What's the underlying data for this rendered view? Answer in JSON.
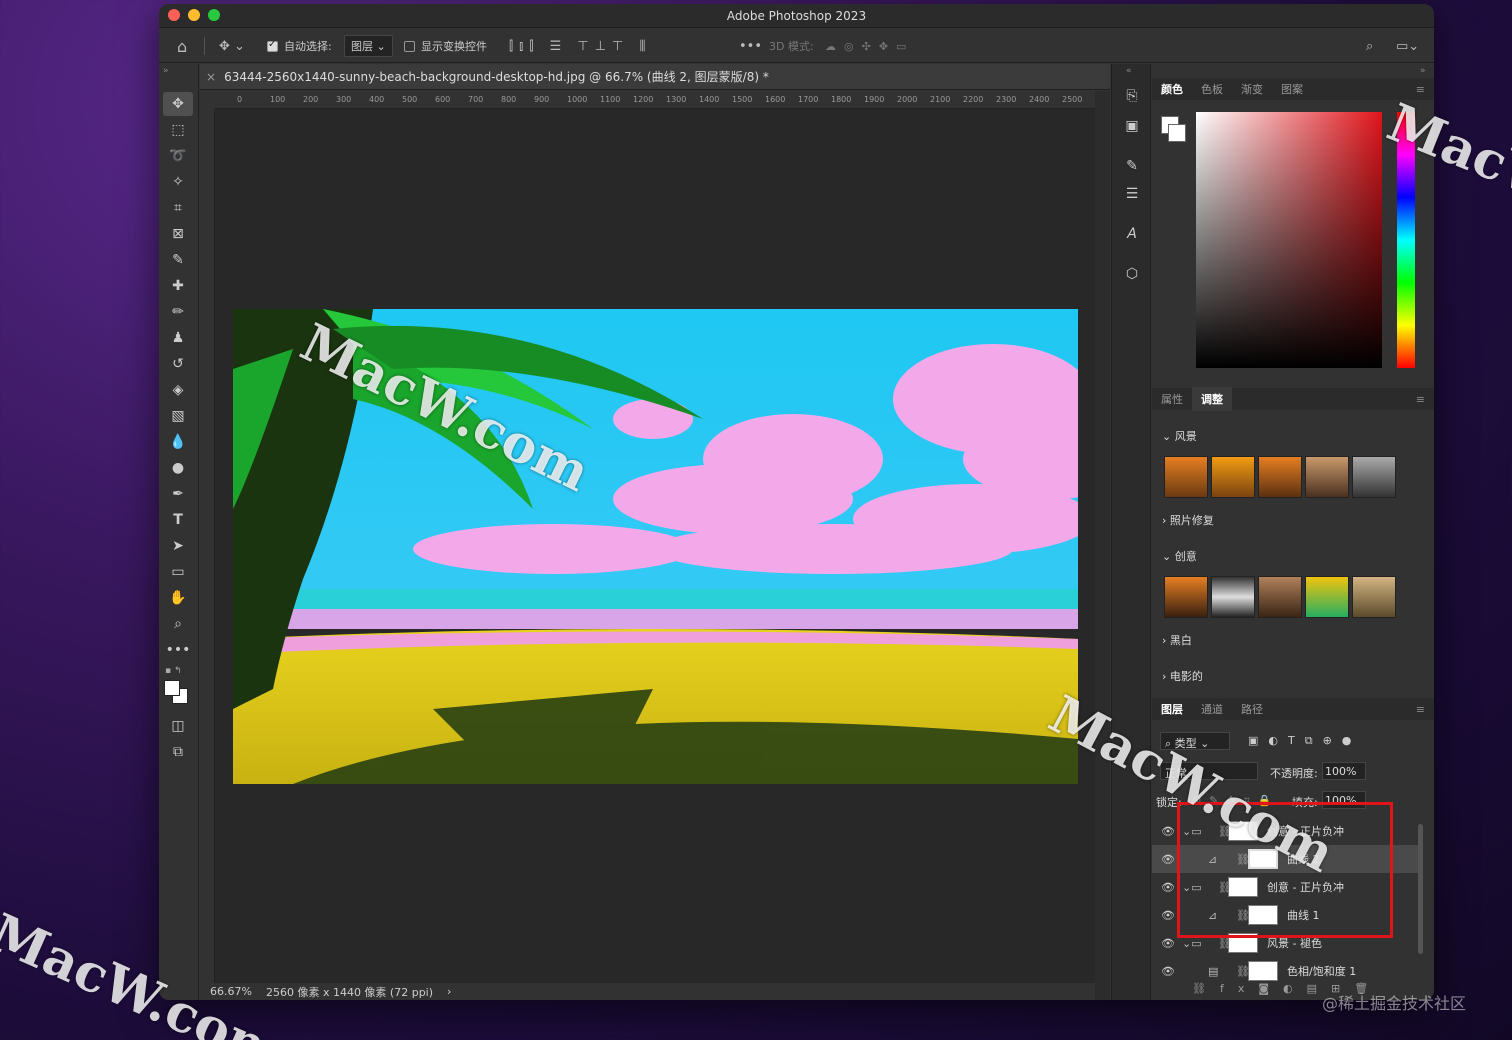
{
  "app_title": "Adobe Photoshop 2023",
  "options_bar": {
    "auto_select_label": "自动选择:",
    "auto_select_value": "图层",
    "show_transform_label": "显示变换控件",
    "mode_3d_label": "3D 模式:"
  },
  "document_tab": {
    "close": "×",
    "title": "63444-2560x1440-sunny-beach-background-desktop-hd.jpg @ 66.7% (曲线 2, 图层蒙版/8) *"
  },
  "ruler_labels": [
    "0",
    "100",
    "200",
    "300",
    "400",
    "500",
    "600",
    "700",
    "800",
    "900",
    "1000",
    "1100",
    "1200",
    "1300",
    "1400",
    "1500",
    "1600",
    "1700",
    "1800",
    "1900",
    "2000",
    "2100",
    "2200",
    "2300",
    "2400",
    "2500"
  ],
  "status_bar": {
    "zoom": "66.67%",
    "doc_info": "2560 像素 x 1440 像素 (72 ppi)",
    "arrow": "›"
  },
  "color_panel": {
    "tabs": [
      "颜色",
      "色板",
      "渐变",
      "图案"
    ]
  },
  "adjust_panel": {
    "tabs": [
      "属性",
      "调整"
    ],
    "sections": [
      {
        "label": "风景",
        "expanded": true
      },
      {
        "label": "照片修复",
        "expanded": false
      },
      {
        "label": "创意",
        "expanded": true
      },
      {
        "label": "黑白",
        "expanded": false
      },
      {
        "label": "电影的",
        "expanded": false
      }
    ]
  },
  "layers_panel": {
    "tabs": [
      "图层",
      "通道",
      "路径"
    ],
    "filter_label": "类型",
    "blend_mode": "正常",
    "opacity_label": "不透明度:",
    "opacity_value": "100%",
    "lock_label": "锁定:",
    "fill_label": "填充:",
    "fill_value": "100%",
    "layers": [
      {
        "name": "创意 - 正片负冲",
        "type": "group"
      },
      {
        "name": "曲线 2",
        "type": "curves",
        "selected": true
      },
      {
        "name": "创意 - 正片负冲",
        "type": "group"
      },
      {
        "name": "曲线 1",
        "type": "curves"
      },
      {
        "name": "风景 - 褪色",
        "type": "group"
      },
      {
        "name": "色相/饱和度 1",
        "type": "huesat"
      }
    ]
  },
  "watermarks": [
    "MacW.com",
    "MacW.com",
    "MacW.com",
    "MacW.com"
  ],
  "bottom_watermark": "@稀土掘金技术社区",
  "colors": {
    "highlight_box": "#e0151b",
    "accent": "#ffffff"
  }
}
